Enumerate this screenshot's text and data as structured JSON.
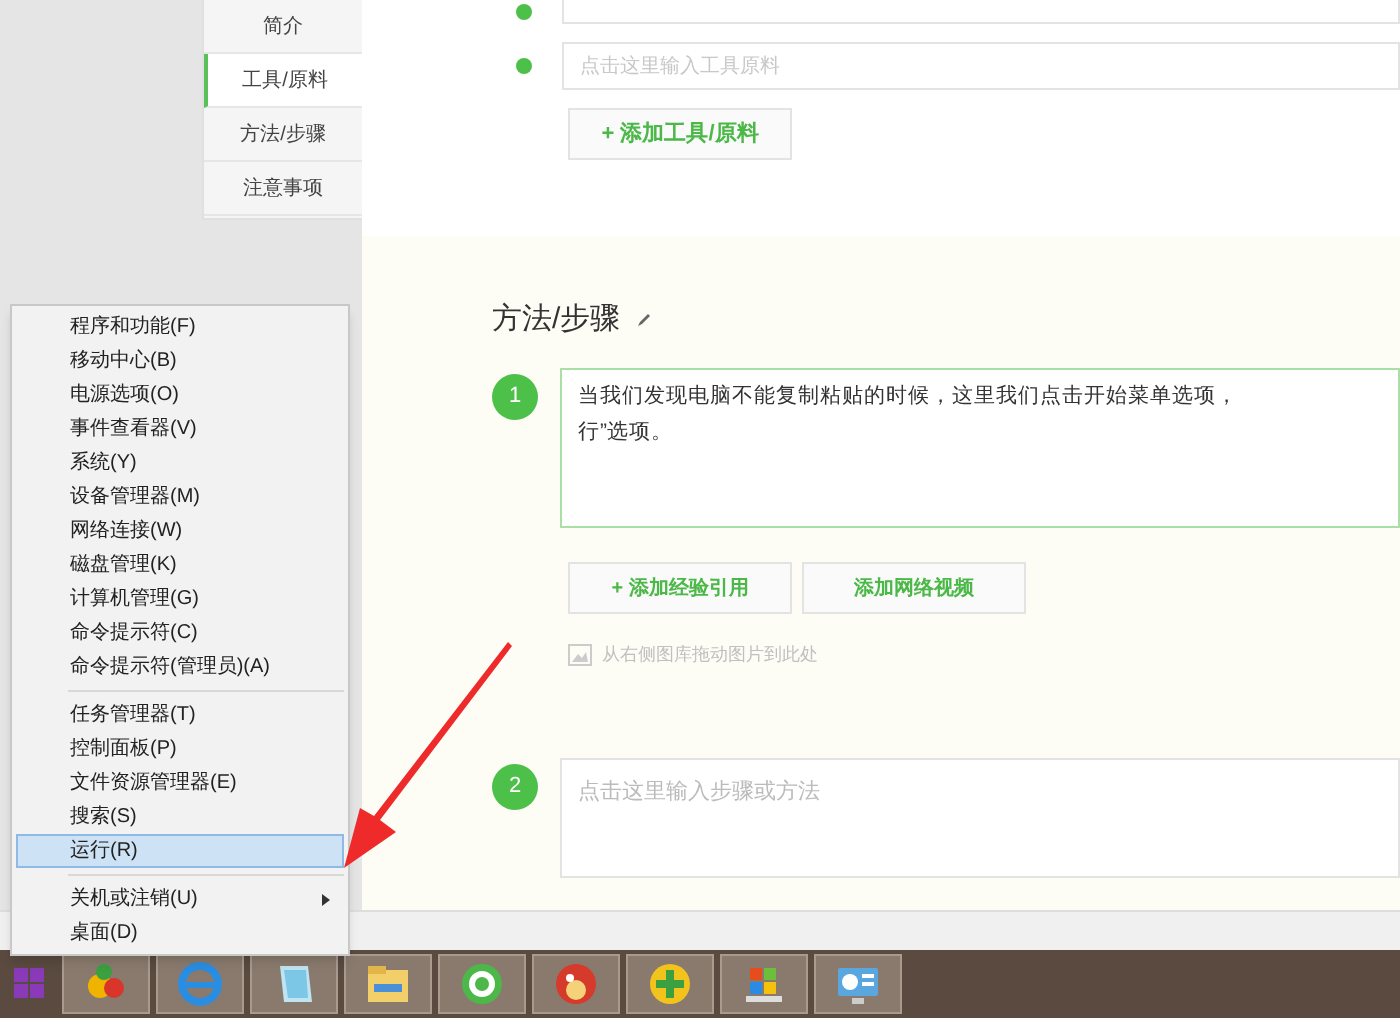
{
  "sidebar": {
    "items": [
      {
        "label": "简介",
        "selected": false
      },
      {
        "label": "工具/原料",
        "selected": true
      },
      {
        "label": "方法/步骤",
        "selected": false
      },
      {
        "label": "注意事项",
        "selected": false
      }
    ]
  },
  "tools": {
    "inputs": [
      {
        "cut_off": true
      },
      {
        "cut_off": false,
        "placeholder": "点击这里输入工具原料"
      }
    ],
    "add_button": "+ 添加工具/原料"
  },
  "steps_section": {
    "title": "方法/步骤",
    "steps": [
      {
        "number": "1",
        "lines": [
          "当我们发现电脑不能复制粘贴的时候，这里我们点击开始菜单选项，",
          "行”选项。"
        ],
        "focused": true
      },
      {
        "number": "2",
        "placeholder": "点击这里输入步骤或方法",
        "focused": false
      }
    ],
    "buttons": [
      "+ 添加经验引用",
      "添加网络视频"
    ],
    "image_hint": "从右侧图库拖动图片到此处"
  },
  "context_menu": {
    "groups": [
      [
        {
          "label": "程序和功能(F)",
          "selected": false,
          "has_submenu": false
        },
        {
          "label": "移动中心(B)",
          "selected": false,
          "has_submenu": false
        },
        {
          "label": "电源选项(O)",
          "selected": false,
          "has_submenu": false
        },
        {
          "label": "事件查看器(V)",
          "selected": false,
          "has_submenu": false
        },
        {
          "label": "系统(Y)",
          "selected": false,
          "has_submenu": false
        },
        {
          "label": "设备管理器(M)",
          "selected": false,
          "has_submenu": false
        },
        {
          "label": "网络连接(W)",
          "selected": false,
          "has_submenu": false
        },
        {
          "label": "磁盘管理(K)",
          "selected": false,
          "has_submenu": false
        },
        {
          "label": "计算机管理(G)",
          "selected": false,
          "has_submenu": false
        },
        {
          "label": "命令提示符(C)",
          "selected": false,
          "has_submenu": false
        },
        {
          "label": "命令提示符(管理员)(A)",
          "selected": false,
          "has_submenu": false
        }
      ],
      [
        {
          "label": "任务管理器(T)",
          "selected": false,
          "has_submenu": false
        },
        {
          "label": "控制面板(P)",
          "selected": false,
          "has_submenu": false
        },
        {
          "label": "文件资源管理器(E)",
          "selected": false,
          "has_submenu": false
        },
        {
          "label": "搜索(S)",
          "selected": false,
          "has_submenu": false
        },
        {
          "label": "运行(R)",
          "selected": true,
          "has_submenu": false
        }
      ],
      [
        {
          "label": "关机或注销(U)",
          "selected": false,
          "has_submenu": true
        },
        {
          "label": "桌面(D)",
          "selected": false,
          "has_submenu": false
        }
      ]
    ]
  },
  "taskbar": {
    "apps": [
      {
        "kind": "fruit"
      },
      {
        "kind": "ie"
      },
      {
        "kind": "notepad"
      },
      {
        "kind": "folder"
      },
      {
        "kind": "green-e"
      },
      {
        "kind": "bird"
      },
      {
        "kind": "plus"
      },
      {
        "kind": "flag"
      },
      {
        "kind": "panel"
      }
    ]
  }
}
